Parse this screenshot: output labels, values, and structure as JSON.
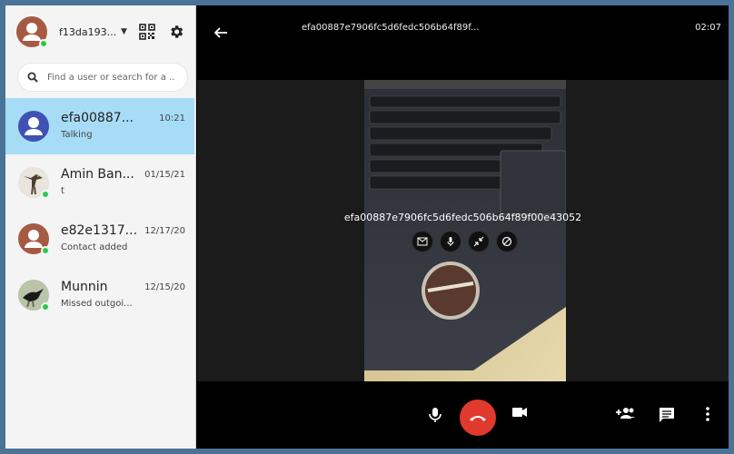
{
  "account": {
    "name": "f13da193...",
    "status": "online"
  },
  "search": {
    "placeholder": "Find a user or search for a ..."
  },
  "conversations": [
    {
      "name": "efa00887...",
      "subtitle": "Talking",
      "time": "10:21",
      "active": true
    },
    {
      "name": "Amin Ban...",
      "subtitle": "t",
      "time": "01/15/21",
      "active": false
    },
    {
      "name": "e82e1317...",
      "subtitle": "Contact added",
      "time": "12/17/20",
      "active": false
    },
    {
      "name": "Munnin",
      "subtitle": "Missed outgoi...",
      "time": "12/15/20",
      "active": false
    }
  ],
  "call": {
    "header_id": "efa00887e7906fc5d6fedc506b64f89f...",
    "timer": "02:07",
    "overlay_name": "efa00887e7906fc5d6fedc506b64f89f00e43052"
  },
  "icons": {
    "qr": "qr-code-icon",
    "settings": "gear-icon",
    "search": "search-icon",
    "back": "arrow-left-icon",
    "mic": "microphone-icon",
    "hangup": "phone-hangup-icon",
    "camera": "video-camera-icon",
    "add_participant": "person-add-icon",
    "chat": "chat-icon",
    "more": "more-vertical-icon"
  },
  "colors": {
    "active_conversation": "#a7dcf6",
    "hangup": "#e2392f",
    "presence": "#2bc94f",
    "frame": "#4a7397"
  }
}
